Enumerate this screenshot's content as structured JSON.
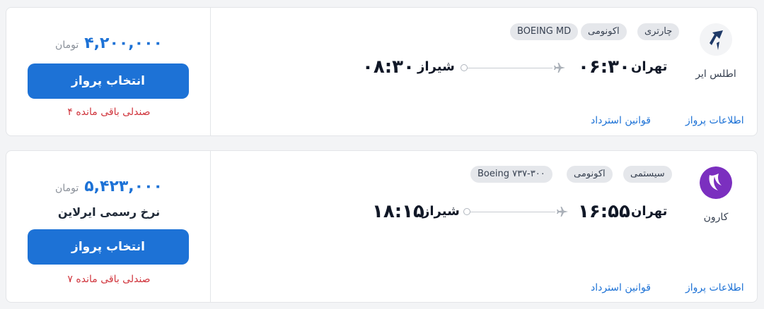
{
  "flights": [
    {
      "airline": "اطلس ایر",
      "tags": [
        "چارتری",
        "اکونومی",
        "BOEING MD"
      ],
      "origin_city": "تهران",
      "departure_time": "۰۶:۳۰",
      "destination_city": "شیراز",
      "arrival_time": "۰۸:۳۰",
      "price": "۴,۲۰۰,۰۰۰",
      "currency": "تومان",
      "fare_note": "",
      "select_label": "انتخاب پرواز",
      "seats_left": "۴ صندلی باقی مانده",
      "links": {
        "flight_info": "اطلاعات پرواز",
        "refund_rules": "قوانین استرداد"
      }
    },
    {
      "airline": "کارون",
      "tags": [
        "سیستمی",
        "اکونومی",
        "Boeing ۷۳۷-۳۰۰"
      ],
      "origin_city": "تهران",
      "departure_time": "۱۶:۵۵",
      "destination_city": "شیراز",
      "arrival_time": "۱۸:۱۵",
      "price": "۵,۴۲۳,۰۰۰",
      "currency": "تومان",
      "fare_note": "نرخ رسمی ایرلاین",
      "select_label": "انتخاب پرواز",
      "seats_left": "۷ صندلی باقی مانده",
      "links": {
        "flight_info": "اطلاعات پرواز",
        "refund_rules": "قوانین استرداد"
      }
    }
  ],
  "colors": {
    "accent": "#1d72d6",
    "seats_warning": "#d0343c",
    "karun_logo": "#7b2fbf",
    "atlas_logo": "#1f3a68"
  }
}
